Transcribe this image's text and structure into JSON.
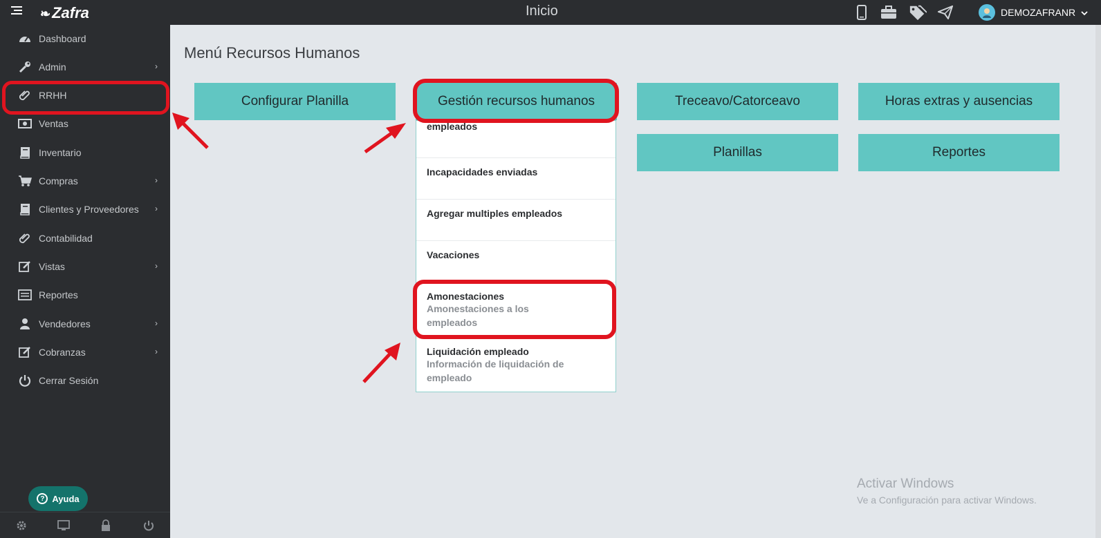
{
  "header": {
    "menu_toggle_icon": "hamburger-icon",
    "logo_text": "Zafra",
    "title": "Inicio",
    "icons": [
      "phone-icon",
      "briefcase-icon",
      "tags-icon",
      "send-icon"
    ],
    "user_name": "DEMOZAFRANR",
    "user_avatar": "avatar-icon"
  },
  "sidebar": {
    "items": [
      {
        "label": "Dashboard",
        "icon": "dashboard-icon",
        "has_submenu": false
      },
      {
        "label": "Admin",
        "icon": "wrench-icon",
        "has_submenu": true
      },
      {
        "label": "RRHH",
        "icon": "paperclip-icon",
        "has_submenu": false
      },
      {
        "label": "Ventas",
        "icon": "money-icon",
        "has_submenu": false
      },
      {
        "label": "Inventario",
        "icon": "book-icon",
        "has_submenu": false
      },
      {
        "label": "Compras",
        "icon": "cart-icon",
        "has_submenu": true
      },
      {
        "label": "Clientes y Proveedores",
        "icon": "book-icon",
        "has_submenu": true
      },
      {
        "label": "Contabilidad",
        "icon": "paperclip-icon",
        "has_submenu": false
      },
      {
        "label": "Vistas",
        "icon": "edit-icon",
        "has_submenu": true
      },
      {
        "label": "Reportes",
        "icon": "list-icon",
        "has_submenu": false
      },
      {
        "label": "Vendedores",
        "icon": "user-icon",
        "has_submenu": true
      },
      {
        "label": "Cobranzas",
        "icon": "edit-icon",
        "has_submenu": true
      },
      {
        "label": "Cerrar Sesión",
        "icon": "power-icon",
        "has_submenu": false
      }
    ],
    "help_label": "Ayuda",
    "bottom_icons": [
      "gear-icon",
      "monitor-icon",
      "lock-icon",
      "power-icon"
    ]
  },
  "main": {
    "title": "Menú Recursos Humanos",
    "tiles": [
      {
        "label": "Configurar Planilla"
      },
      {
        "label": "Gestión recursos humanos"
      },
      {
        "label": "Treceavo/Catorceavo"
      },
      {
        "label": "Horas extras y ausencias"
      },
      {
        "label": "Planillas"
      },
      {
        "label": "Reportes"
      }
    ],
    "dropdown": [
      {
        "title": "empleados",
        "subtitle": ""
      },
      {
        "title": "Incapacidades enviadas",
        "subtitle": ""
      },
      {
        "title": "Agregar multiples empleados",
        "subtitle": ""
      },
      {
        "title": "Vacaciones",
        "subtitle": ""
      },
      {
        "title": "Amonestaciones",
        "subtitle": "Amonestaciones a los empleados"
      },
      {
        "title": "Liquidación empleado",
        "subtitle": "Información de liquidación de empleado"
      }
    ]
  },
  "watermark": {
    "title": "Activar Windows",
    "subtitle": "Ve a Configuración para activar Windows."
  },
  "colors": {
    "tile": "#61c6c2",
    "annotation_red": "#e0141f",
    "sidebar_bg": "#2b2d30"
  }
}
